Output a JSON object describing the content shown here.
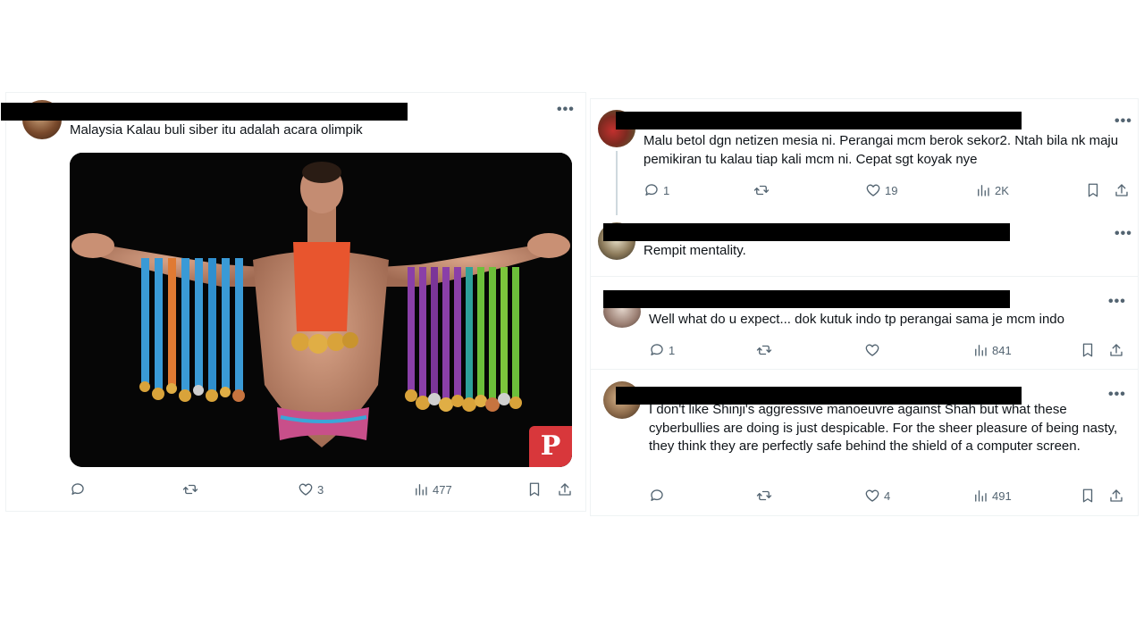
{
  "post": {
    "text": "Malaysia Kalau buli siber itu adalah acara olimpik",
    "more": "•••",
    "actions": {
      "replies": "",
      "reposts": "",
      "likes": "3",
      "views": "477"
    },
    "badge": "P"
  },
  "replies": [
    {
      "text": "Malu betol dgn netizen mesia ni. Perangai mcm berok sekor2. Ntah bila nk maju pemikiran tu kalau tiap kali mcm ni. Cepat sgt koyak nye",
      "more": "•••",
      "actions": {
        "replies": "1",
        "reposts": "",
        "likes": "19",
        "views": "2K"
      }
    },
    {
      "text": "Rempit mentality.",
      "more": "•••"
    },
    {
      "text": "Well what do u expect... dok kutuk indo tp perangai sama je mcm indo",
      "more": "•••",
      "actions": {
        "replies": "1",
        "reposts": "",
        "likes": "",
        "views": "841"
      }
    },
    {
      "text": "I don't like Shinji's aggressive manoeuvre against Shah but what these cyberbullies are doing is just despicable. For the sheer pleasure of being nasty, they think they are perfectly safe behind the shield of a computer screen.",
      "more": "•••",
      "actions": {
        "replies": "",
        "reposts": "",
        "likes": "4",
        "views": "491"
      }
    }
  ],
  "colors": {
    "action": "#536471",
    "divider": "#eff3f4",
    "pinterest": "#d8373b"
  }
}
